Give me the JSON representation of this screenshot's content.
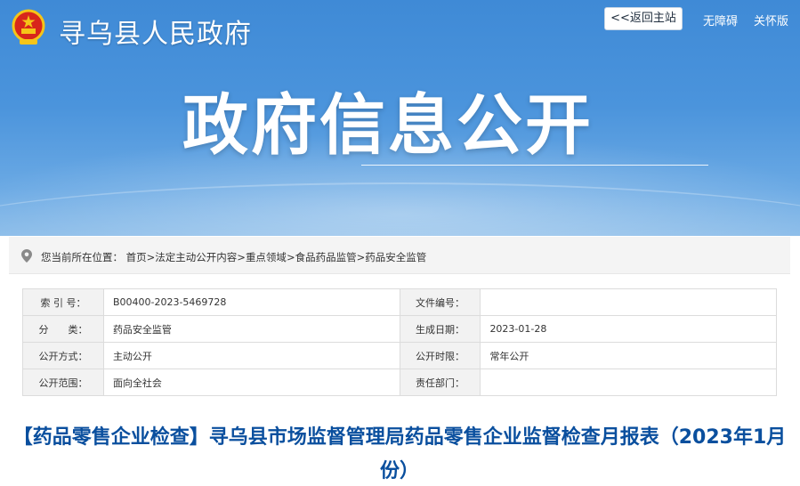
{
  "header": {
    "site_title": "寻乌县人民政府",
    "back_button": "<<返回主站",
    "accessibility_link": "无障碍",
    "care_link": "关怀版",
    "banner_title": "政府信息公开"
  },
  "breadcrumb": {
    "prefix": "您当前所在位置：",
    "items": [
      "首页",
      "法定主动公开内容",
      "重点领域",
      "食品药品监管",
      "药品安全监管"
    ],
    "separator": ">"
  },
  "meta": {
    "rows": [
      {
        "label1": "索 引 号：",
        "value1": "B00400-2023-5469728",
        "label2": "文件编号：",
        "value2": ""
      },
      {
        "label1": "分　　类：",
        "value1": "药品安全监管",
        "label2": "生成日期：",
        "value2": "2023-01-28"
      },
      {
        "label1": "公开方式：",
        "value1": "主动公开",
        "label2": "公开时限：",
        "value2": "常年公开"
      },
      {
        "label1": "公开范围：",
        "value1": "面向全社会",
        "label2": "责任部门：",
        "value2": ""
      }
    ]
  },
  "article": {
    "title": "【药品零售企业检查】寻乌县市场监督管理局药品零售企业监督检查月报表（2023年1月份）"
  },
  "colors": {
    "banner": "#4b94dc",
    "title_blue": "#0a4f9e",
    "emblem_red": "#d8261b",
    "emblem_gold": "#f5c518"
  }
}
